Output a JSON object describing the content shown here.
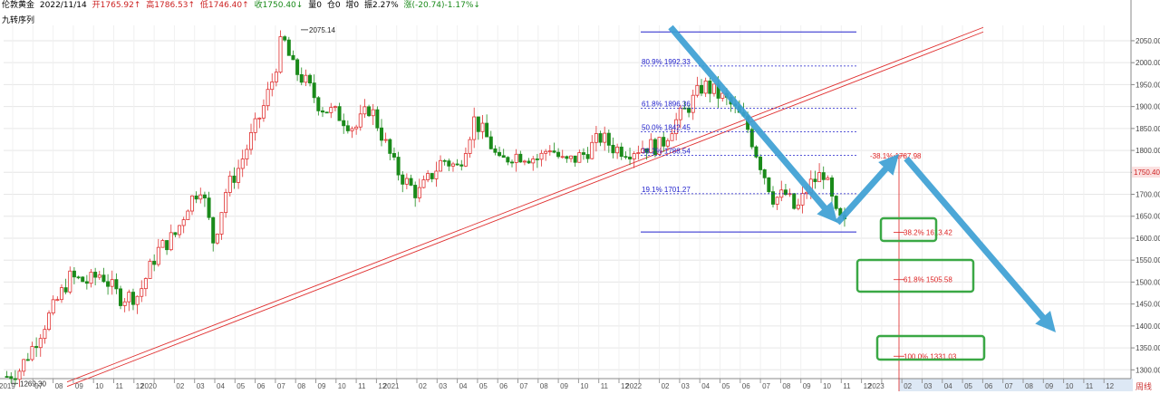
{
  "header": {
    "symbol": "伦敦黄金",
    "date": "2022/11/14",
    "open": "开1765.92↑",
    "high": "高1786.53↑",
    "low": "低1746.40↑",
    "close": "收1750.40↓",
    "volume": "量0",
    "position": "仓0",
    "increase": "增0",
    "amplitude": "振2.27%",
    "change": "涨(-20.74)-1.17%↓"
  },
  "indicator_label": "九转序列",
  "period_label": "周线",
  "colors": {
    "up": "#e03030",
    "down": "#1a8a1a",
    "fib": "#2222cc",
    "proj": "#dd2222",
    "arrow": "#3d9fd4",
    "box": "#3aa845",
    "nine_up": "#cc22cc",
    "nine_dn": "#44aa22"
  },
  "chart_data": {
    "type": "candlestick",
    "title": "",
    "ylim": [
      1280,
      2085
    ],
    "y_ticks": [
      1300,
      1350,
      1400,
      1450,
      1500,
      1550,
      1600,
      1650,
      1700,
      1750,
      1800,
      1850,
      1900,
      1950,
      2000,
      2050
    ],
    "last_price": 1750.4,
    "x_ticks": [
      "2019",
      "07",
      "08",
      "09",
      "10",
      "11",
      "12",
      "2020",
      "02",
      "03",
      "04",
      "05",
      "06",
      "07",
      "08",
      "09",
      "10",
      "11",
      "12",
      "2021",
      "02",
      "03",
      "04",
      "05",
      "06",
      "07",
      "08",
      "09",
      "10",
      "11",
      "12",
      "2022",
      "02",
      "03",
      "04",
      "05",
      "06",
      "07",
      "08",
      "09",
      "10",
      "11",
      "12",
      "2023",
      "02",
      "03",
      "04",
      "05",
      "06",
      "07",
      "08",
      "09",
      "10",
      "11",
      "12"
    ],
    "candle_anchors": [
      [
        0,
        1285
      ],
      [
        10,
        1300
      ],
      [
        20,
        1350
      ],
      [
        35,
        1430
      ],
      [
        50,
        1510
      ],
      [
        65,
        1500
      ],
      [
        75,
        1520
      ],
      [
        90,
        1465
      ],
      [
        105,
        1470
      ],
      [
        120,
        1570
      ],
      [
        135,
        1610
      ],
      [
        145,
        1680
      ],
      [
        155,
        1720
      ],
      [
        165,
        1590
      ],
      [
        175,
        1710
      ],
      [
        185,
        1760
      ],
      [
        195,
        1830
      ],
      [
        205,
        1900
      ],
      [
        213,
        1970
      ],
      [
        220,
        2060
      ],
      [
        228,
        1990
      ],
      [
        240,
        1950
      ],
      [
        250,
        1900
      ],
      [
        265,
        1880
      ],
      [
        278,
        1850
      ],
      [
        290,
        1900
      ],
      [
        300,
        1830
      ],
      [
        310,
        1760
      ],
      [
        318,
        1730
      ],
      [
        328,
        1700
      ],
      [
        338,
        1740
      ],
      [
        348,
        1780
      ],
      [
        360,
        1760
      ],
      [
        373,
        1870
      ],
      [
        385,
        1820
      ],
      [
        393,
        1770
      ],
      [
        403,
        1790
      ],
      [
        413,
        1790
      ],
      [
        425,
        1780
      ],
      [
        433,
        1810
      ],
      [
        445,
        1770
      ],
      [
        460,
        1790
      ],
      [
        474,
        1830
      ],
      [
        485,
        1805
      ],
      [
        497,
        1800
      ],
      [
        510,
        1810
      ],
      [
        522,
        1810
      ],
      [
        532,
        1860
      ],
      [
        544,
        1900
      ],
      [
        556,
        1950
      ],
      [
        566,
        1930
      ],
      [
        576,
        1910
      ],
      [
        590,
        1860
      ],
      [
        600,
        1780
      ],
      [
        612,
        1690
      ],
      [
        622,
        1700
      ],
      [
        630,
        1660
      ],
      [
        640,
        1720
      ],
      [
        652,
        1750
      ],
      [
        662,
        1650
      ],
      [
        672,
        1620
      ]
    ],
    "annotations": [
      {
        "text": "2075.14",
        "type": "high"
      },
      {
        "text": "1269.30",
        "type": "low"
      }
    ],
    "fibonacci_retracement": [
      {
        "label": "80.9% 1992.33",
        "value": 1992.33
      },
      {
        "label": "61.8% 1896.36",
        "value": 1896.36
      },
      {
        "label": "50.0% 1842.45",
        "value": 1842.45
      },
      {
        "label": "38.2% 1788.54",
        "value": 1788.54
      },
      {
        "label": "19.1% 1701.27",
        "value": 1701.27
      }
    ],
    "fib_range": {
      "high": 2070,
      "low": 1614
    },
    "projection": [
      {
        "label": "-38.1% 1787.98",
        "value": 1787.98
      },
      {
        "label": "38.2% 1613.42",
        "value": 1613.42
      },
      {
        "label": "61.8% 1505.58",
        "value": 1505.58
      },
      {
        "label": "100.0% 1331.03",
        "value": 1331.03
      }
    ],
    "trendline": {
      "from": [
        "2019",
        1262
      ],
      "to": [
        "2023-05",
        2070
      ]
    }
  }
}
